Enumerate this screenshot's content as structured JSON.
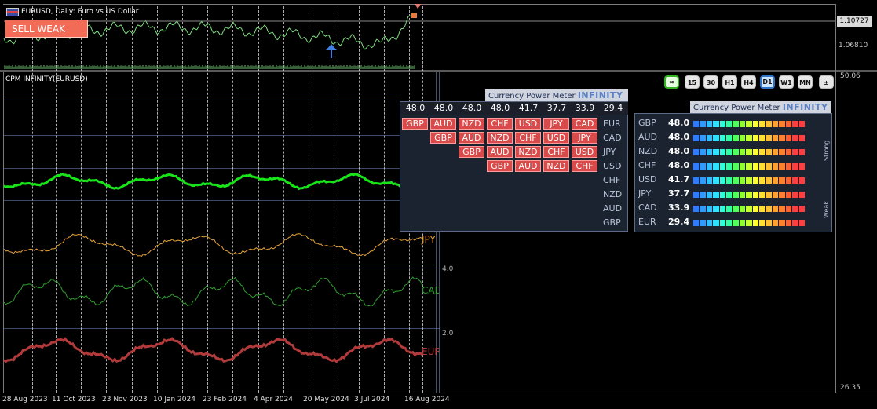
{
  "window": {
    "title": "EURUSD, Daily:  Euro vs US Dollar",
    "signal_badge": "SELL WEAK",
    "current_price": "1.10727",
    "price_axis": [
      "1.06810"
    ],
    "indicator_name": "CPM INFINITY(EURUSD)",
    "indicator_axis": [
      "50.06",
      "4.0",
      "2.0",
      "26.35"
    ]
  },
  "timeframes": [
    "∞",
    "15",
    "30",
    "H1",
    "H4",
    "D1",
    "W1",
    "MN",
    "±"
  ],
  "active_timeframe": "D1",
  "matrix_panel": {
    "title": "Currency Power Meter",
    "brand": "INFINITY",
    "values": [
      "48.0",
      "48.0",
      "48.0",
      "48.0",
      "41.7",
      "37.7",
      "33.9",
      "29.4"
    ],
    "rows": [
      {
        "cells": [
          "GBP",
          "AUD",
          "NZD",
          "CHF",
          "USD",
          "JPY",
          "CAD"
        ],
        "label": "EUR"
      },
      {
        "cells": [
          "GBP",
          "AUD",
          "NZD",
          "CHF",
          "USD",
          "JPY"
        ],
        "label": "CAD"
      },
      {
        "cells": [
          "GBP",
          "AUD",
          "NZD",
          "CHF",
          "USD"
        ],
        "label": "JPY"
      },
      {
        "cells": [
          "GBP",
          "AUD",
          "NZD",
          "CHF"
        ],
        "label": "USD"
      },
      {
        "cells": [],
        "label": "CHF"
      },
      {
        "cells": [],
        "label": "NZD"
      },
      {
        "cells": [],
        "label": "AUD"
      },
      {
        "cells": [],
        "label": "GBP"
      }
    ]
  },
  "meter_panel": {
    "title": "Currency Power Meter",
    "brand": "INFINITY",
    "strong_label": "Strong",
    "weak_label": "Weak",
    "rows": [
      {
        "currency": "GBP",
        "value": "48.0"
      },
      {
        "currency": "AUD",
        "value": "48.0"
      },
      {
        "currency": "NZD",
        "value": "48.0"
      },
      {
        "currency": "CHF",
        "value": "48.0"
      },
      {
        "currency": "USD",
        "value": "41.7"
      },
      {
        "currency": "JPY",
        "value": "37.7"
      },
      {
        "currency": "CAD",
        "value": "33.9"
      },
      {
        "currency": "EUR",
        "value": "29.4"
      }
    ]
  },
  "chart_data": {
    "type": "line",
    "symbol": "EURUSD",
    "x_ticks": [
      "28 Aug 2023",
      "11 Oct 2023",
      "23 Nov 2023",
      "10 Jan 2024",
      "23 Feb 2024",
      "4 Apr 2024",
      "20 May 2024",
      "3 Jul 2024",
      "16 Aug 2024"
    ],
    "price_axis_ticks": [
      "1.10727",
      "1.06810"
    ],
    "indicator_axis_ticks": [
      "50.06",
      "4.0",
      "2.0",
      "26.35"
    ],
    "series": [
      {
        "name": "JPY",
        "color": "#e8a33a"
      },
      {
        "name": "CAD",
        "color": "#2f9e2f"
      },
      {
        "name": "EUR",
        "color": "#b33a3a"
      }
    ],
    "colors": {
      "price": "#7ee07e",
      "green_line": "#19e619",
      "buy_arrow": "#3e7fe0",
      "sell_badge": "#f26b57",
      "cell_red": "#d94b4b"
    }
  }
}
